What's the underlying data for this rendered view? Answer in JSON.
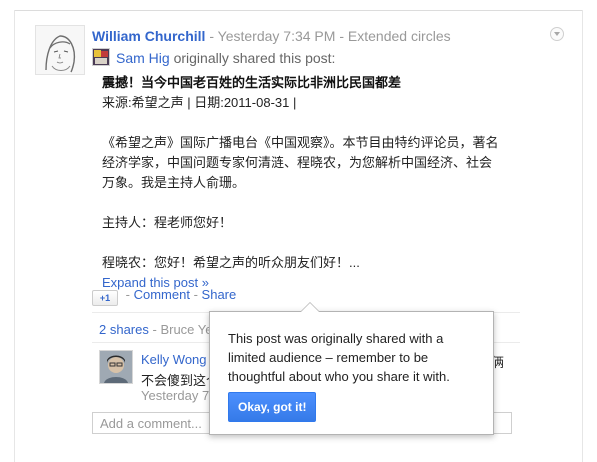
{
  "post": {
    "author": "William Churchill",
    "separator": "-",
    "timestamp": "Yesterday 7:34 PM",
    "audience": "Extended circles",
    "original_sharer": "Sam Hig",
    "shared_text": "originally shared this post:",
    "title": "震撼！当今中国老百姓的生活实际比非洲比民国都差",
    "source_line": "来源:希望之声 | 日期:2011-08-31 |",
    "paragraph_1": "《希望之声》国际广播电台《中国观察》。本节目由特约评论员，著名经济学家，中国问题专家何清涟、程晓农，为您解析中国经济、社会万象。我是主持人俞珊。",
    "paragraph_2": "主持人：程老师您好！",
    "paragraph_3": "程晓农：您好！希望之声的听众朋友们好！...",
    "expand_label": "Expand this post »"
  },
  "actions": {
    "plus_one": "+1",
    "separator": "-",
    "comment_label": "Comment",
    "share_label": "Share"
  },
  "shares": {
    "count_label": "2 shares",
    "sharers_preview": "- Bruce Ye"
  },
  "comment": {
    "author": "Kelly Wong",
    "text_visible": "不会傻到这个",
    "text_tail": "俩",
    "time_visible": "Yesterday 7"
  },
  "add_comment": {
    "placeholder": "Add a comment..."
  },
  "tooltip": {
    "message": "This post was originally shared with a limited audience – remember to be thoughtful about who you share it with.",
    "button_label": "Okay, got it!"
  },
  "colors": {
    "link": "#3366cc",
    "button": "#4d90fe",
    "muted": "#999999"
  }
}
